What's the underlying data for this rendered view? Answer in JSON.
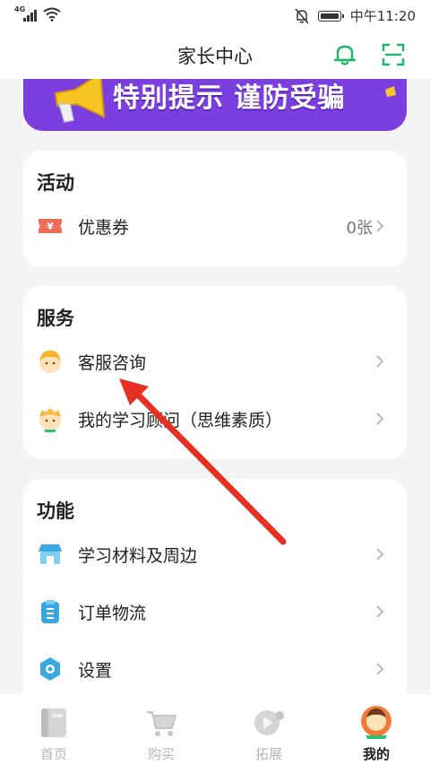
{
  "status_bar": {
    "network": "4G",
    "time": "中午11:20"
  },
  "header": {
    "title": "家长中心"
  },
  "banner": {
    "text": "特别提示 谨防受骗"
  },
  "activity": {
    "title": "活动",
    "items": [
      {
        "label": "优惠券",
        "value": "0张",
        "icon": "coupon-icon"
      }
    ]
  },
  "service": {
    "title": "服务",
    "items": [
      {
        "label": "客服咨询",
        "icon": "customer-service-avatar-icon"
      },
      {
        "label": "我的学习顾问（思维素质）",
        "icon": "advisor-avatar-icon"
      }
    ]
  },
  "function": {
    "title": "功能",
    "items": [
      {
        "label": "学习材料及周边",
        "icon": "store-icon"
      },
      {
        "label": "订单物流",
        "icon": "clipboard-icon"
      },
      {
        "label": "设置",
        "icon": "settings-icon"
      }
    ]
  },
  "tabs": [
    {
      "label": "首页",
      "icon": "home-book-icon"
    },
    {
      "label": "购买",
      "icon": "cart-icon"
    },
    {
      "label": "拓展",
      "icon": "play-icon"
    },
    {
      "label": "我的",
      "icon": "user-avatar-icon",
      "active": true
    }
  ],
  "colors": {
    "accent_green": "#1fb86b",
    "banner_purple": "#7b3fe0",
    "annotation_arrow": "#e53022"
  }
}
